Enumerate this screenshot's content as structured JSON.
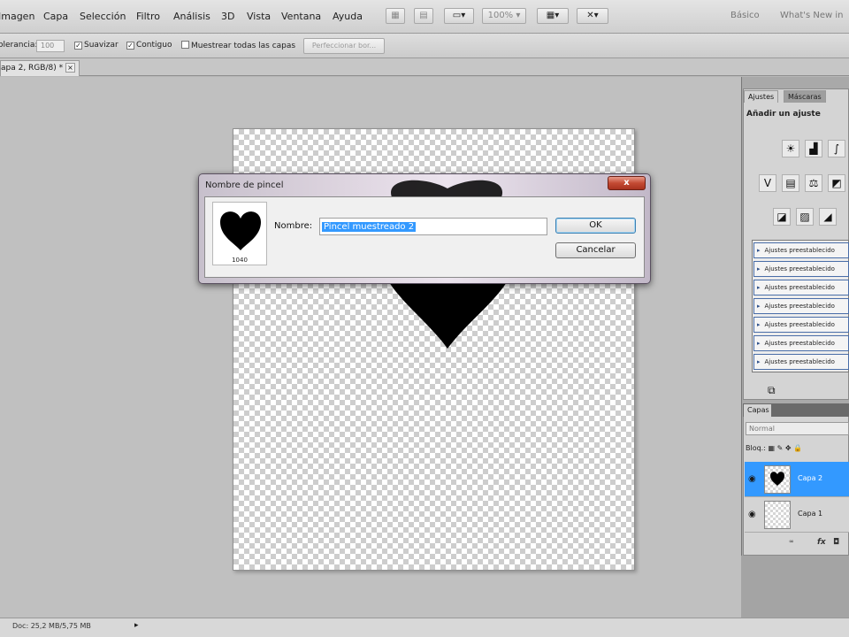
{
  "menubar": {
    "items": [
      "Imagen",
      "Capa",
      "Selección",
      "Filtro",
      "Análisis",
      "3D",
      "Vista",
      "Ventana",
      "Ayuda"
    ],
    "zoom": "100%",
    "workspaces": [
      "Básico",
      "What's New in"
    ]
  },
  "options": {
    "tolerance_label": "olerancia:",
    "tolerance_value": "100",
    "smooth": "Suavizar",
    "contiguous": "Contiguo",
    "sample_all": "Muestrear todas las capas",
    "refine": "Perfeccionar bor..."
  },
  "document": {
    "tab_label": "apa 2, RGB/8) *",
    "status": "Doc: 25,2 MB/5,75 MB"
  },
  "adjustments": {
    "tabs": [
      "Ajustes",
      "Máscaras"
    ],
    "title": "Añadir un ajuste",
    "presets": [
      "Ajustes preestablecido",
      "Ajustes preestablecido",
      "Ajustes preestablecido",
      "Ajustes preestablecido",
      "Ajustes preestablecido",
      "Ajustes preestablecido",
      "Ajustes preestablecido"
    ]
  },
  "layers": {
    "tab": "Capas",
    "blend_mode": "Normal",
    "lock_label": "Bloq.:",
    "items": [
      {
        "name": "Capa 2",
        "selected": true
      },
      {
        "name": "Capa 1",
        "selected": false
      }
    ]
  },
  "dialog": {
    "title": "Nombre de pincel",
    "close_glyph": "x",
    "brush_size": "1040",
    "name_label": "Nombre:",
    "name_value": "Pincel muestreado 2",
    "ok_label": "OK",
    "cancel_label": "Cancelar"
  },
  "colors": {
    "selection": "#3399ff",
    "layer_selected": "#3399ff",
    "close_button": "#c44a33"
  }
}
